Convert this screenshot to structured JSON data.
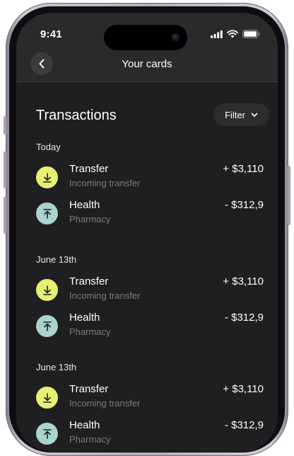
{
  "status_bar": {
    "time": "9:41"
  },
  "header": {
    "title": "Your cards"
  },
  "transactions": {
    "heading": "Transactions",
    "filter_label": "Filter",
    "groups": [
      {
        "date": "Today",
        "items": [
          {
            "name": "Transfer",
            "detail": "Incoming transfer",
            "amount": "+ $3,110",
            "direction": "incoming",
            "icon": "arrow-down-to-line-icon",
            "color": "#e7f072"
          },
          {
            "name": "Health",
            "detail": "Pharmacy",
            "amount": "- $312,9",
            "direction": "outgoing",
            "icon": "arrow-up-from-line-icon",
            "color": "#a9d3cf"
          }
        ]
      },
      {
        "date": "June 13th",
        "items": [
          {
            "name": "Transfer",
            "detail": "Incoming transfer",
            "amount": "+ $3,110",
            "direction": "incoming",
            "icon": "arrow-down-to-line-icon",
            "color": "#e7f072"
          },
          {
            "name": "Health",
            "detail": "Pharmacy",
            "amount": "- $312,9",
            "direction": "outgoing",
            "icon": "arrow-up-from-line-icon",
            "color": "#a9d3cf"
          }
        ]
      },
      {
        "date": "June 13th",
        "items": [
          {
            "name": "Transfer",
            "detail": "Incoming transfer",
            "amount": "+ $3,110",
            "direction": "incoming",
            "icon": "arrow-down-to-line-icon",
            "color": "#e7f072"
          },
          {
            "name": "Health",
            "detail": "Pharmacy",
            "amount": "- $312,9",
            "direction": "outgoing",
            "icon": "arrow-up-from-line-icon",
            "color": "#a9d3cf"
          }
        ]
      }
    ]
  }
}
